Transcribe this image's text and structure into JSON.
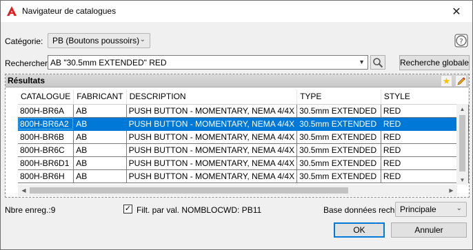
{
  "window": {
    "title": "Navigateur de catalogues",
    "close_glyph": "✕"
  },
  "category": {
    "label": "Catégorie:",
    "value": "PB (Boutons poussoirs)"
  },
  "search": {
    "label": "Rechercher:",
    "value": "AB \"30.5mm EXTENDED\" RED",
    "global_button": "Recherche globale"
  },
  "results": {
    "title": "Résultats",
    "columns": [
      "CATALOGUE",
      "FABRICANT",
      "DESCRIPTION",
      "TYPE",
      "STYLE"
    ],
    "rows": [
      [
        "800H-BR6A",
        "AB",
        "PUSH BUTTON - MOMENTARY, NEMA 4/4X",
        "30.5mm EXTENDED",
        "RED"
      ],
      [
        "800H-BR6A2",
        "AB",
        "PUSH BUTTON - MOMENTARY, NEMA 4/4X",
        "30.5mm EXTENDED",
        "RED"
      ],
      [
        "800H-BR6B",
        "AB",
        "PUSH BUTTON - MOMENTARY, NEMA 4/4X",
        "30.5mm EXTENDED",
        "RED"
      ],
      [
        "800H-BR6C",
        "AB",
        "PUSH BUTTON - MOMENTARY, NEMA 4/4X",
        "30.5mm EXTENDED",
        "RED"
      ],
      [
        "800H-BR6D1",
        "AB",
        "PUSH BUTTON - MOMENTARY, NEMA 4/4X",
        "30.5mm EXTENDED",
        "RED"
      ],
      [
        "800H-BR6H",
        "AB",
        "PUSH BUTTON - MOMENTARY, NEMA 4/4X",
        "30.5mm EXTENDED",
        "RED"
      ]
    ],
    "selected_row": 1
  },
  "footer": {
    "record_count": "Nbre enreg.:9",
    "filter_label": "Filt. par val. NOMBLOCWD: PB11",
    "filter_checked": true,
    "db_label": "Base données rech.:",
    "db_value": "Principale",
    "ok_label": "OK",
    "cancel_label": "Annuler"
  },
  "colors": {
    "accent": "#0078d7",
    "brand": "#e02020"
  }
}
